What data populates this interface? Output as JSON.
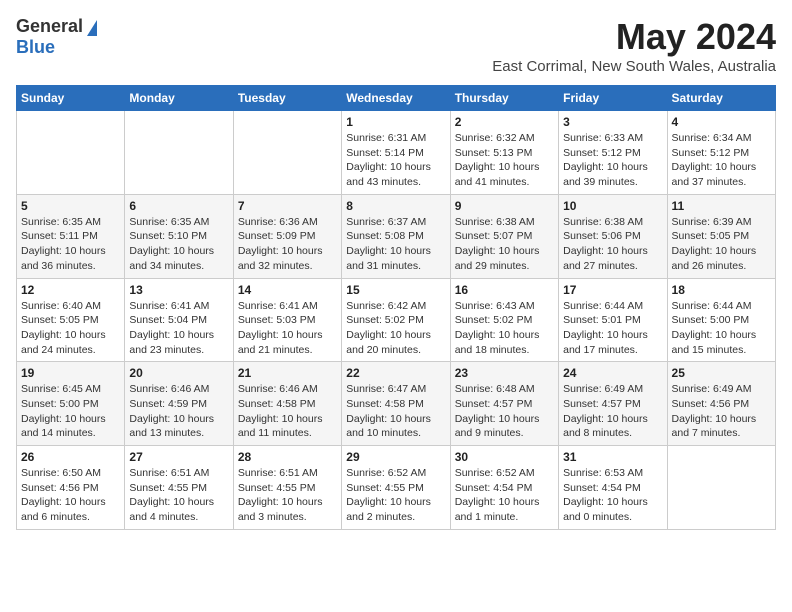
{
  "header": {
    "logo_general": "General",
    "logo_blue": "Blue",
    "month_year": "May 2024",
    "location": "East Corrimal, New South Wales, Australia"
  },
  "calendar": {
    "days_of_week": [
      "Sunday",
      "Monday",
      "Tuesday",
      "Wednesday",
      "Thursday",
      "Friday",
      "Saturday"
    ],
    "weeks": [
      [
        {
          "day": "",
          "info": ""
        },
        {
          "day": "",
          "info": ""
        },
        {
          "day": "",
          "info": ""
        },
        {
          "day": "1",
          "info": "Sunrise: 6:31 AM\nSunset: 5:14 PM\nDaylight: 10 hours\nand 43 minutes."
        },
        {
          "day": "2",
          "info": "Sunrise: 6:32 AM\nSunset: 5:13 PM\nDaylight: 10 hours\nand 41 minutes."
        },
        {
          "day": "3",
          "info": "Sunrise: 6:33 AM\nSunset: 5:12 PM\nDaylight: 10 hours\nand 39 minutes."
        },
        {
          "day": "4",
          "info": "Sunrise: 6:34 AM\nSunset: 5:12 PM\nDaylight: 10 hours\nand 37 minutes."
        }
      ],
      [
        {
          "day": "5",
          "info": "Sunrise: 6:35 AM\nSunset: 5:11 PM\nDaylight: 10 hours\nand 36 minutes."
        },
        {
          "day": "6",
          "info": "Sunrise: 6:35 AM\nSunset: 5:10 PM\nDaylight: 10 hours\nand 34 minutes."
        },
        {
          "day": "7",
          "info": "Sunrise: 6:36 AM\nSunset: 5:09 PM\nDaylight: 10 hours\nand 32 minutes."
        },
        {
          "day": "8",
          "info": "Sunrise: 6:37 AM\nSunset: 5:08 PM\nDaylight: 10 hours\nand 31 minutes."
        },
        {
          "day": "9",
          "info": "Sunrise: 6:38 AM\nSunset: 5:07 PM\nDaylight: 10 hours\nand 29 minutes."
        },
        {
          "day": "10",
          "info": "Sunrise: 6:38 AM\nSunset: 5:06 PM\nDaylight: 10 hours\nand 27 minutes."
        },
        {
          "day": "11",
          "info": "Sunrise: 6:39 AM\nSunset: 5:05 PM\nDaylight: 10 hours\nand 26 minutes."
        }
      ],
      [
        {
          "day": "12",
          "info": "Sunrise: 6:40 AM\nSunset: 5:05 PM\nDaylight: 10 hours\nand 24 minutes."
        },
        {
          "day": "13",
          "info": "Sunrise: 6:41 AM\nSunset: 5:04 PM\nDaylight: 10 hours\nand 23 minutes."
        },
        {
          "day": "14",
          "info": "Sunrise: 6:41 AM\nSunset: 5:03 PM\nDaylight: 10 hours\nand 21 minutes."
        },
        {
          "day": "15",
          "info": "Sunrise: 6:42 AM\nSunset: 5:02 PM\nDaylight: 10 hours\nand 20 minutes."
        },
        {
          "day": "16",
          "info": "Sunrise: 6:43 AM\nSunset: 5:02 PM\nDaylight: 10 hours\nand 18 minutes."
        },
        {
          "day": "17",
          "info": "Sunrise: 6:44 AM\nSunset: 5:01 PM\nDaylight: 10 hours\nand 17 minutes."
        },
        {
          "day": "18",
          "info": "Sunrise: 6:44 AM\nSunset: 5:00 PM\nDaylight: 10 hours\nand 15 minutes."
        }
      ],
      [
        {
          "day": "19",
          "info": "Sunrise: 6:45 AM\nSunset: 5:00 PM\nDaylight: 10 hours\nand 14 minutes."
        },
        {
          "day": "20",
          "info": "Sunrise: 6:46 AM\nSunset: 4:59 PM\nDaylight: 10 hours\nand 13 minutes."
        },
        {
          "day": "21",
          "info": "Sunrise: 6:46 AM\nSunset: 4:58 PM\nDaylight: 10 hours\nand 11 minutes."
        },
        {
          "day": "22",
          "info": "Sunrise: 6:47 AM\nSunset: 4:58 PM\nDaylight: 10 hours\nand 10 minutes."
        },
        {
          "day": "23",
          "info": "Sunrise: 6:48 AM\nSunset: 4:57 PM\nDaylight: 10 hours\nand 9 minutes."
        },
        {
          "day": "24",
          "info": "Sunrise: 6:49 AM\nSunset: 4:57 PM\nDaylight: 10 hours\nand 8 minutes."
        },
        {
          "day": "25",
          "info": "Sunrise: 6:49 AM\nSunset: 4:56 PM\nDaylight: 10 hours\nand 7 minutes."
        }
      ],
      [
        {
          "day": "26",
          "info": "Sunrise: 6:50 AM\nSunset: 4:56 PM\nDaylight: 10 hours\nand 6 minutes."
        },
        {
          "day": "27",
          "info": "Sunrise: 6:51 AM\nSunset: 4:55 PM\nDaylight: 10 hours\nand 4 minutes."
        },
        {
          "day": "28",
          "info": "Sunrise: 6:51 AM\nSunset: 4:55 PM\nDaylight: 10 hours\nand 3 minutes."
        },
        {
          "day": "29",
          "info": "Sunrise: 6:52 AM\nSunset: 4:55 PM\nDaylight: 10 hours\nand 2 minutes."
        },
        {
          "day": "30",
          "info": "Sunrise: 6:52 AM\nSunset: 4:54 PM\nDaylight: 10 hours\nand 1 minute."
        },
        {
          "day": "31",
          "info": "Sunrise: 6:53 AM\nSunset: 4:54 PM\nDaylight: 10 hours\nand 0 minutes."
        },
        {
          "day": "",
          "info": ""
        }
      ]
    ]
  }
}
